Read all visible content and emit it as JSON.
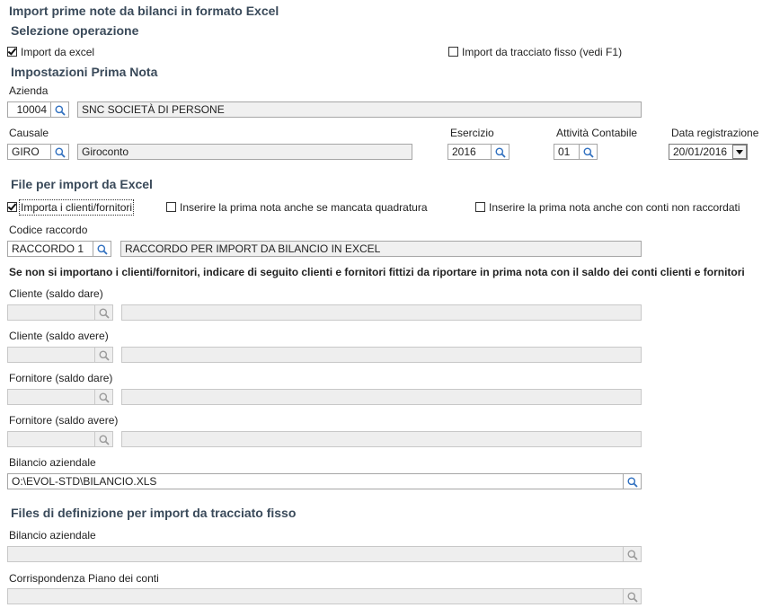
{
  "page_title": "Import prime note da bilanci in formato Excel",
  "sections": {
    "operation": "Selezione operazione",
    "settings": "Impostazioni Prima Nota",
    "excel": "File per import da Excel",
    "fixed": "Files di definizione per import da tracciato fisso"
  },
  "operation": {
    "import_excel": {
      "label": "Import da excel",
      "checked": true
    },
    "import_fixed": {
      "label": "Import da tracciato fisso (vedi F1)",
      "checked": false
    }
  },
  "azienda": {
    "label": "Azienda",
    "code": "10004",
    "description": "SNC  SOCIETÀ DI PERSONE"
  },
  "causale": {
    "label": "Causale",
    "code": "GIRO",
    "description": "Giroconto"
  },
  "esercizio": {
    "label": "Esercizio",
    "value": "2016"
  },
  "attivita": {
    "label": "Attività Contabile",
    "value": "01"
  },
  "data_registrazione": {
    "label": "Data registrazione",
    "value": "20/01/2016"
  },
  "excel_options": {
    "import_clienti": {
      "label": "Importa i clienti/fornitori",
      "checked": true
    },
    "mancata_quadratura": {
      "label": "Inserire la prima nota anche se mancata quadratura",
      "checked": false
    },
    "conti_non_raccordati": {
      "label": "Inserire la prima nota anche con conti non  raccordati",
      "checked": false
    }
  },
  "codice_raccordo": {
    "label": "Codice raccordo",
    "code": "RACCORDO 1",
    "description": "RACCORDO PER IMPORT DA BILANCIO IN EXCEL"
  },
  "note": "Se non si importano i clienti/fornitori, indicare di seguito clienti e fornitori fittizi da riportare in prima nota con il saldo dei conti clienti e fornitori",
  "cliente_dare": {
    "label": "Cliente (saldo dare)",
    "code": "",
    "description": ""
  },
  "cliente_avere": {
    "label": "Cliente (saldo avere)",
    "code": "",
    "description": ""
  },
  "fornitore_dare": {
    "label": "Fornitore (saldo dare)",
    "code": "",
    "description": ""
  },
  "fornitore_avere": {
    "label": "Fornitore (saldo avere)",
    "code": "",
    "description": ""
  },
  "bilancio_excel": {
    "label": "Bilancio aziendale",
    "value": "O:\\EVOL-STD\\BILANCIO.XLS"
  },
  "bilancio_fisso": {
    "label": "Bilancio aziendale",
    "value": ""
  },
  "piano_conti": {
    "label": "Corrispondenza Piano dei conti",
    "value": ""
  }
}
